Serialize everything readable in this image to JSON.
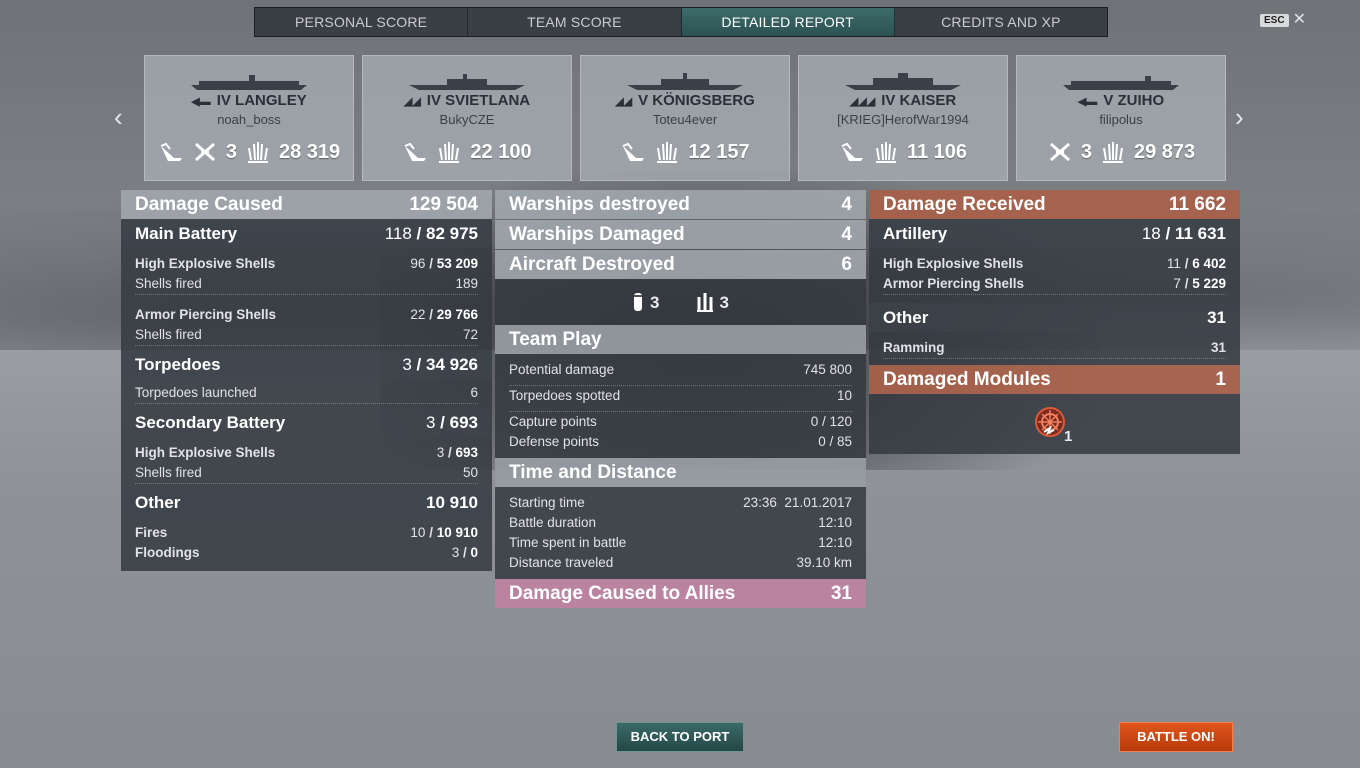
{
  "tabs": [
    {
      "label": "PERSONAL SCORE"
    },
    {
      "label": "TEAM SCORE"
    },
    {
      "label": "DETAILED REPORT",
      "active": true
    },
    {
      "label": "CREDITS AND XP"
    }
  ],
  "esc": {
    "key": "ESC",
    "close": "✕"
  },
  "nav": {
    "prev": "‹",
    "next": "›"
  },
  "ships": [
    {
      "tier_name": "IV LANGLEY",
      "player": "noah_boss",
      "class_icon": "carrier-icon",
      "planes": "3",
      "damage": "28 319"
    },
    {
      "tier_name": "IV SVIETLANA",
      "player": "BukyCZE",
      "class_icon": "cruiser-icon",
      "planes": "",
      "damage": "22 100"
    },
    {
      "tier_name": "V KÖNIGSBERG",
      "player": "Toteu4ever",
      "class_icon": "cruiser-icon",
      "planes": "",
      "damage": "12 157"
    },
    {
      "tier_name": "IV KAISER",
      "player": "[KRIEG]HerofWar1994",
      "class_icon": "battleship-icon",
      "planes": "",
      "damage": "11 106"
    },
    {
      "tier_name": "V ZUIHO",
      "player": "filipolus",
      "class_icon": "carrier-icon",
      "planes": "3",
      "damage": "29 873"
    }
  ],
  "left": {
    "damage_caused": {
      "label": "Damage Caused",
      "value": "129 504"
    },
    "main_battery": {
      "label": "Main Battery",
      "hits": "118",
      "dmg": "82 975"
    },
    "mb_he": {
      "label": "High Explosive Shells",
      "hits": "96",
      "dmg": "53 209"
    },
    "mb_he_fired": {
      "label": "Shells fired",
      "value": "189"
    },
    "mb_ap": {
      "label": "Armor Piercing Shells",
      "hits": "22",
      "dmg": "29 766"
    },
    "mb_ap_fired": {
      "label": "Shells fired",
      "value": "72"
    },
    "torpedoes": {
      "label": "Torpedoes",
      "hits": "3",
      "dmg": "34 926"
    },
    "torp_launched": {
      "label": "Torpedoes launched",
      "value": "6"
    },
    "secondary": {
      "label": "Secondary Battery",
      "hits": "3",
      "dmg": "693"
    },
    "sec_he": {
      "label": "High Explosive Shells",
      "hits": "3",
      "dmg": "693"
    },
    "sec_fired": {
      "label": "Shells fired",
      "value": "50"
    },
    "other": {
      "label": "Other",
      "value": "10 910"
    },
    "fires": {
      "label": "Fires",
      "hits": "10",
      "dmg": "10 910"
    },
    "floodings": {
      "label": "Floodings",
      "hits": "3",
      "dmg": "0"
    }
  },
  "middle": {
    "warships_destroyed": {
      "label": "Warships destroyed",
      "value": "4"
    },
    "warships_damaged": {
      "label": "Warships Damaged",
      "value": "4"
    },
    "aircraft_destroyed": {
      "label": "Aircraft Destroyed",
      "value": "6"
    },
    "aircraft_icons": [
      {
        "icon": "bomber-icon",
        "count": "3"
      },
      {
        "icon": "fighter-squad-icon",
        "count": "3"
      }
    ],
    "team_play": {
      "label": "Team Play"
    },
    "potential_damage": {
      "label": "Potential damage",
      "value": "745 800"
    },
    "torpedoes_spotted": {
      "label": "Torpedoes spotted",
      "value": "10"
    },
    "capture_points": {
      "label": "Capture points",
      "value": "0 / 120"
    },
    "defense_points": {
      "label": "Defense points",
      "value": "0 / 85"
    },
    "time_distance": {
      "label": "Time and Distance"
    },
    "starting_time": {
      "label": "Starting time",
      "value": "23:36  21.01.2017"
    },
    "battle_duration": {
      "label": "Battle duration",
      "value": "12:10"
    },
    "time_in_battle": {
      "label": "Time spent in battle",
      "value": "12:10"
    },
    "distance": {
      "label": "Distance traveled",
      "value": "39.10 km"
    },
    "damage_allies": {
      "label": "Damage Caused to Allies",
      "value": "31"
    }
  },
  "right": {
    "damage_received": {
      "label": "Damage Received",
      "value": "11 662"
    },
    "artillery": {
      "label": "Artillery",
      "hits": "18",
      "dmg": "11 631"
    },
    "he": {
      "label": "High Explosive Shells",
      "hits": "11",
      "dmg": "6 402"
    },
    "ap": {
      "label": "Armor Piercing Shells",
      "hits": "7",
      "dmg": "5 229"
    },
    "other": {
      "label": "Other",
      "value": "31"
    },
    "ramming": {
      "label": "Ramming",
      "value": "31"
    },
    "damaged_modules": {
      "label": "Damaged Modules",
      "value": "1"
    },
    "module_icon": {
      "icon": "steering-gear-icon",
      "count": "1"
    }
  },
  "buttons": {
    "back": "BACK TO PORT",
    "battle": "BATTLE ON!"
  },
  "colors": {
    "accent_orange": "#d84a14",
    "teal": "#2f5a58",
    "received": "#aa5f48",
    "allies": "#be82a0"
  }
}
